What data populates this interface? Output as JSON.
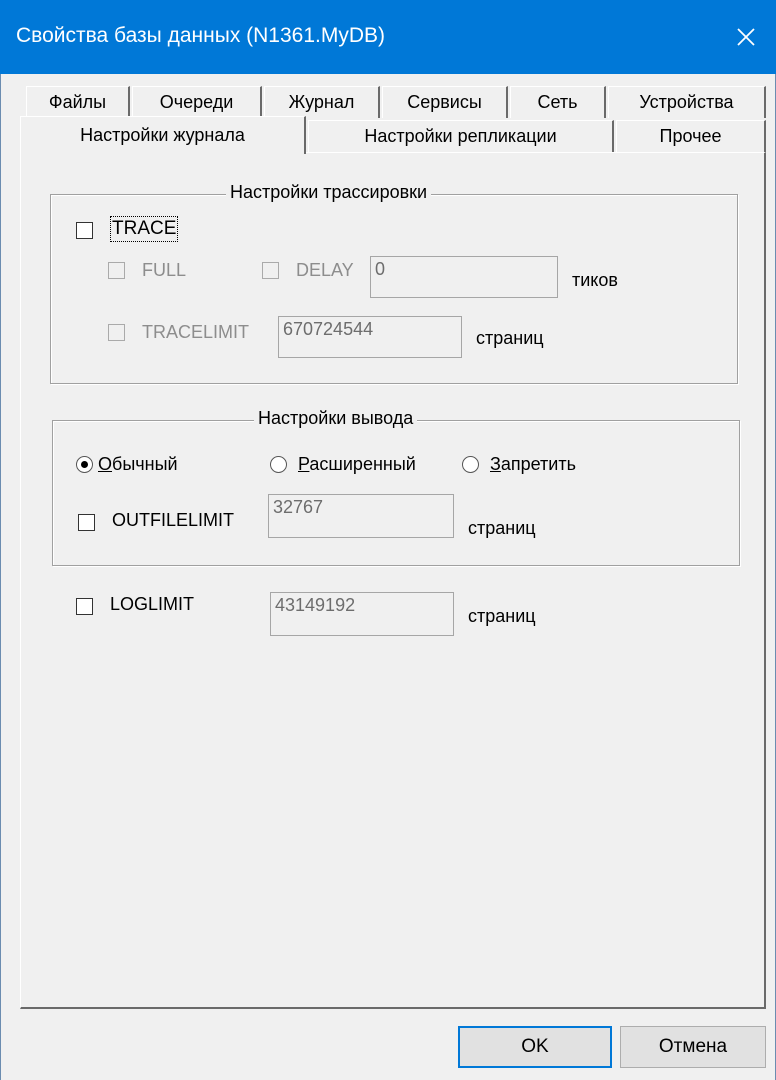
{
  "window": {
    "title": "Свойства базы данных (N1361.MyDB)"
  },
  "tabs_row1": [
    "Файлы",
    "Очереди",
    "Журнал",
    "Сервисы",
    "Сеть",
    "Устройства"
  ],
  "tabs_row2": [
    "Настройки журнала",
    "Настройки репликации",
    "Прочее"
  ],
  "trace_group": {
    "title": "Настройки трассировки",
    "trace_label": "TRACE",
    "full_label": "FULL",
    "delay_label": "DELAY",
    "delay_value": "0",
    "delay_unit": "тиков",
    "tracelimit_label": "TRACELIMIT",
    "tracelimit_value": "670724544",
    "tracelimit_unit": "страниц"
  },
  "output_group": {
    "title": "Настройки вывода",
    "radio_normal": {
      "prefix": "О",
      "rest": "бычный",
      "selected": true
    },
    "radio_extended": {
      "prefix": "Р",
      "rest": "асширенный",
      "selected": false
    },
    "radio_forbid": {
      "prefix": "З",
      "rest": "апретить",
      "selected": false
    },
    "outfilelimit_label": "OUTFILELIMIT",
    "outfilelimit_value": "32767",
    "outfilelimit_unit": "страниц"
  },
  "loglimit": {
    "label": "LOGLIMIT",
    "value": "43149192",
    "unit": "страниц"
  },
  "buttons": {
    "ok": "OK",
    "cancel": "Отмена"
  }
}
